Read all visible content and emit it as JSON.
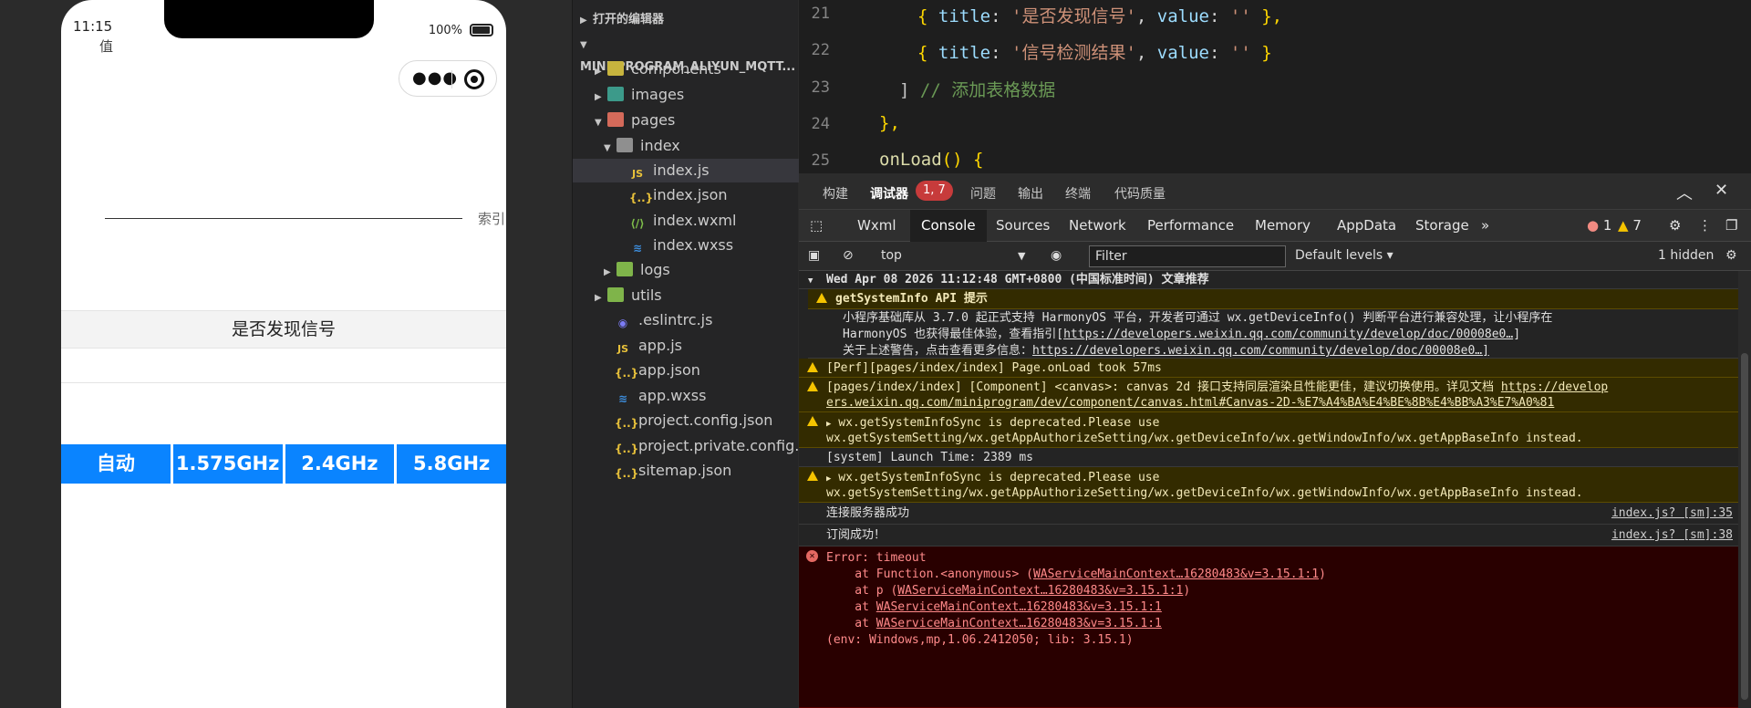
{
  "simulator": {
    "time": "11:15",
    "time_extra": "值",
    "battery": "100%",
    "index_label": "索引",
    "signal_row_label": "是否发现信号",
    "buttons": [
      "自动",
      "1.575GHz",
      "2.4GHz",
      "5.8GHz"
    ],
    "accent": "#0a84ff"
  },
  "explorer": {
    "section_open_editors": "打开的编辑器",
    "section_project": "MINI_PROGRAM_ALIYUN_MQTT...",
    "items": [
      {
        "label": "components",
        "icon": "folder-icon"
      },
      {
        "label": "images",
        "icon": "folder-icon"
      },
      {
        "label": "pages",
        "icon": "folder-icon"
      },
      {
        "label": "index",
        "icon": "folder-icon"
      },
      {
        "label": "index.js",
        "icon": "js-file-icon"
      },
      {
        "label": "index.json",
        "icon": "json-file-icon"
      },
      {
        "label": "index.wxml",
        "icon": "wxml-file-icon"
      },
      {
        "label": "index.wxss",
        "icon": "wxss-file-icon"
      },
      {
        "label": "logs",
        "icon": "folder-icon"
      },
      {
        "label": "utils",
        "icon": "folder-icon"
      },
      {
        "label": ".eslintrc.js",
        "icon": "eslint-icon"
      },
      {
        "label": "app.js",
        "icon": "js-file-icon"
      },
      {
        "label": "app.json",
        "icon": "json-file-icon"
      },
      {
        "label": "app.wxss",
        "icon": "wxss-file-icon"
      },
      {
        "label": "project.config.json",
        "icon": "json-file-icon"
      },
      {
        "label": "project.private.config.js...",
        "icon": "json-file-icon"
      },
      {
        "label": "sitemap.json",
        "icon": "json-file-icon"
      }
    ],
    "icon_glyphs": {
      "js": "JS",
      "json": "{..}",
      "css": "≋",
      "wxml": "⟨/⟩",
      "lint": "◉"
    }
  },
  "editor": {
    "lines": [
      {
        "n": "21",
        "title_key": "title",
        "title_val": "'是否发现信号'",
        "value_key": "value",
        "value_val": "''",
        "trail": " },"
      },
      {
        "n": "22",
        "title_key": "title",
        "title_val": "'信号检测结果'",
        "value_key": "value",
        "value_val": "''",
        "trail": " }"
      },
      {
        "n": "23",
        "bracket": "]",
        "comment": " // 添加表格数据"
      },
      {
        "n": "24",
        "text": "},"
      },
      {
        "n": "25",
        "fn": "onLoad",
        "rest": "() {"
      }
    ]
  },
  "devtools": {
    "top_tabs": [
      "构建",
      "调试器",
      "问题",
      "输出",
      "终端",
      "代码质量"
    ],
    "debugger_badge": "1, 7",
    "panel_tabs": [
      "Wxml",
      "Console",
      "Sources",
      "Network",
      "Performance",
      "Memory",
      "AppData",
      "Storage"
    ],
    "more_tabs": "»",
    "error_count": "1",
    "warn_count": "7",
    "context": "top",
    "filter_placeholder": "Filter",
    "levels": "Default levels",
    "hidden": "1 hidden",
    "log": {
      "group_header": "Wed Apr 08 2026 11:12:48 GMT+0800 (中国标准时间) 文章推荐",
      "w1_title": "getSystemInfo API 提示",
      "w1_l1": "小程序基础库从 3.7.0 起正式支持 HarmonyOS 平台，开发者可通过 wx.getDeviceInfo() 判断平台进行兼容处理，让小程序在",
      "w1_l2a": "HarmonyOS 也获得最佳体验，查看指引[",
      "w1_l2link": "https://developers.weixin.qq.com/community/develop/doc/00008e0…",
      "w1_l2b": "]",
      "w1_l3a": "关于上述警告，点击查看更多信息：",
      "w1_l3link": "https://developers.weixin.qq.com/community/develop/doc/00008e0…]",
      "perf": "[Perf][pages/index/index] Page.onLoad took 57ms",
      "comp_l1a": "[pages/index/index] [Component] <canvas>: canvas 2d 接口支持同层渲染且性能更佳，建议切换使用。详见文档 ",
      "comp_l1link": "https://develop",
      "comp_l2link": "ers.weixin.qq.com/miniprogram/dev/component/canvas.html#Canvas-2D-%E7%A4%BA%E4%BE%8B%E4%BB%A3%E7%A0%81",
      "dep_l1": "wx.getSystemInfoSync is deprecated.Please use",
      "dep_l2": "wx.getSystemSetting/wx.getAppAuthorizeSetting/wx.getDeviceInfo/wx.getWindowInfo/wx.getAppBaseInfo instead.",
      "launch": "[system] Launch Time: 2389 ms",
      "connect": "连接服务器成功",
      "connect_src": "index.js? [sm]:35",
      "subscribe": "订阅成功！",
      "subscribe_src": "index.js? [sm]:38",
      "err_l1": "Error: timeout",
      "err_l2a": "    at Function.<anonymous> (",
      "err_l2link": "WAServiceMainContext…16280483&v=3.15.1:1",
      "err_l2b": ")",
      "err_l3a": "    at p (",
      "err_l3link": "WAServiceMainContext…16280483&v=3.15.1:1",
      "err_l3b": ")",
      "err_l4a": "    at ",
      "err_l4link": "WAServiceMainContext…16280483&v=3.15.1:1",
      "err_l5a": "    at ",
      "err_l5link": "WAServiceMainContext…16280483&v=3.15.1:1",
      "err_l6": "(env: Windows,mp,1.06.2412050; lib: 3.15.1)"
    }
  }
}
